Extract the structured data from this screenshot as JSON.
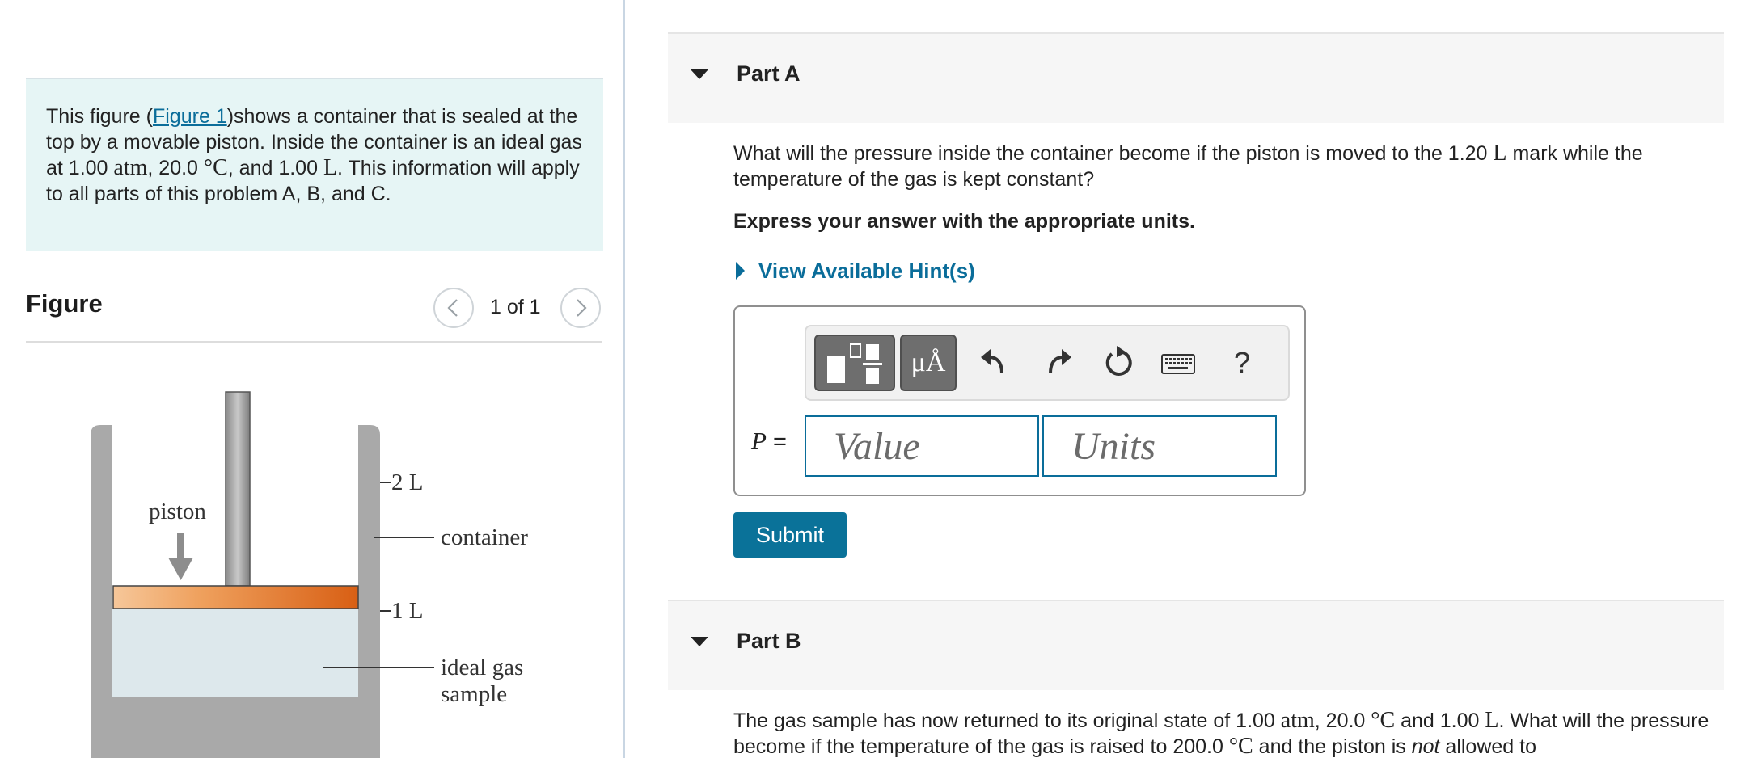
{
  "intro": {
    "text_1": "This figure (",
    "figure_link": "Figure 1",
    "text_2": ")shows a container that is sealed at the top by a movable piston. Inside the container is an ideal gas at 1.00 ",
    "unit_atm": "atm",
    "text_3": ", 20.0 ",
    "unit_degC": "°C",
    "text_4": ", and 1.00 ",
    "unit_L": "L",
    "text_5": ". This information will apply to all parts of this problem A, B, and C."
  },
  "figure_panel": {
    "title": "Figure",
    "pager": "1 of 1",
    "labels": {
      "two_liter": "2 L",
      "one_liter": "1 L",
      "piston": "piston",
      "container": "container",
      "gas_line1": "ideal gas",
      "gas_line2": "sample"
    }
  },
  "partA": {
    "label": "Part A",
    "question_1": "What will the pressure inside the container become if the piston is moved to the 1.20 ",
    "question_unit": "L",
    "question_2": " mark while the temperature of the gas is kept constant?",
    "express": "Express your answer with the appropriate units.",
    "hint": "View Available Hint(s)",
    "toolbar": {
      "templates_icon": "fraction-templates-icon",
      "units_label": "μÅ",
      "undo_icon": "undo-icon",
      "redo_icon": "redo-icon",
      "reset_icon": "reset-icon",
      "keyboard_icon": "keyboard-icon",
      "help_label": "?"
    },
    "variable": "P",
    "equals": " =",
    "value_placeholder": "Value",
    "units_placeholder": "Units",
    "submit": "Submit"
  },
  "partB": {
    "label": "Part B",
    "question_1": "The gas sample has now returned to its original state of 1.00 ",
    "unit_atm": "atm",
    "question_2": ", 20.0 ",
    "unit_degC": "°C",
    "question_3": " and 1.00 ",
    "unit_L": "L",
    "question_4": ". What will the pressure become if the temperature of the gas is raised to 200.0 ",
    "unit_degC2": "°C",
    "question_5": " and the piston is ",
    "emph": "not",
    "question_6": " allowed to"
  },
  "colors": {
    "link": "#0a6d9a",
    "submit_bg": "#0a7299",
    "intro_bg": "#e6f5f5",
    "piston_orange": "#e2742a",
    "gas_fill": "#dde8ec",
    "wall_gray": "#a9a9a9"
  }
}
